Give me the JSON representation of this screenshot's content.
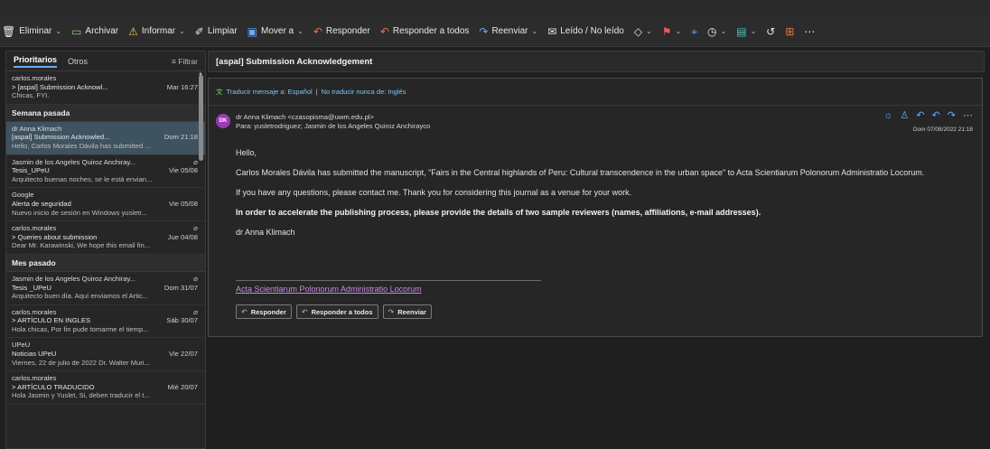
{
  "toolbar": {
    "items": [
      {
        "icon": "trash-icon",
        "glyph": "🗑",
        "label": "Eliminar",
        "chev": true,
        "color": ""
      },
      {
        "icon": "archive-icon",
        "glyph": "▭",
        "label": "Archivar",
        "chev": false,
        "color": "#7ad06a"
      },
      {
        "icon": "warning-icon",
        "glyph": "⚠",
        "label": "Informar",
        "chev": true,
        "color": "#f2c94c"
      },
      {
        "icon": "broom-icon",
        "glyph": "✐",
        "label": "Limpiar",
        "chev": false,
        "color": ""
      },
      {
        "icon": "folder-move-icon",
        "glyph": "▣",
        "label": "Mover a",
        "chev": true,
        "color": "#6aa9ff"
      },
      {
        "icon": "reply-icon",
        "glyph": "↶",
        "label": "Responder",
        "chev": false,
        "color": "#e8734a"
      },
      {
        "icon": "reply-all-icon",
        "glyph": "↶",
        "label": "Responder a todos",
        "chev": false,
        "color": "#e8734a"
      },
      {
        "icon": "forward-icon",
        "glyph": "↷",
        "label": "Reenviar",
        "chev": true,
        "color": "#6aa9ff"
      },
      {
        "icon": "envelope-icon",
        "glyph": "✉",
        "label": "Leído / No leído",
        "chev": false,
        "color": ""
      }
    ],
    "extras": [
      {
        "icon": "tag-icon",
        "glyph": "◇",
        "color": "",
        "chev": true
      },
      {
        "icon": "flag-icon",
        "glyph": "⚑",
        "color": "#f05a5a",
        "chev": true
      },
      {
        "icon": "pin-icon",
        "glyph": "⌖",
        "color": "#6aa9ff",
        "chev": false
      },
      {
        "icon": "clock-icon",
        "glyph": "◷",
        "color": "",
        "chev": true
      },
      {
        "icon": "rules-icon",
        "glyph": "▤",
        "color": "#4fc3c0",
        "chev": true
      },
      {
        "icon": "undo-icon",
        "glyph": "↺",
        "color": "",
        "chev": false
      },
      {
        "icon": "apps-icon",
        "glyph": "⊞",
        "color": "#e8734a",
        "chev": false
      },
      {
        "icon": "more-icon",
        "glyph": "⋯",
        "color": "",
        "chev": false
      }
    ]
  },
  "list": {
    "tab_focused": "Prioritarios",
    "tab_other": "Otros",
    "filter": "Filtrar",
    "groups": [
      {
        "title": "",
        "messages": [
          {
            "from": "carlos.morales",
            "subject": "> [aspal] Submission Acknowl...",
            "date": "Mar 16:27",
            "preview": "Chicas, FYI.",
            "clip": false,
            "selected": false
          }
        ]
      },
      {
        "title": "Semana pasada",
        "messages": [
          {
            "from": "dr Anna Klimach",
            "subject": "[aspal] Submission Acknowled...",
            "date": "Dom 21:18",
            "preview": "Hello, Carlos Morales Dávila has submitted ...",
            "clip": false,
            "selected": true
          },
          {
            "from": "Jasmin de los Angeles Quiroz Anchiray...",
            "subject": "Tesis_UPeU",
            "date": "Vie 05/08",
            "preview": "Arquitecto buenas noches, se le está envian...",
            "clip": true,
            "selected": false
          },
          {
            "from": "Google",
            "subject": "Alerta de seguridad",
            "date": "Vie 05/08",
            "preview": "Nuevo inicio de sesión en Windows yusletr...",
            "clip": false,
            "selected": false
          },
          {
            "from": "carlos.morales",
            "subject": "> Queries about submission",
            "date": "Jue 04/08",
            "preview": "Dear Mr. Karawinski, We hope this email fin...",
            "clip": true,
            "selected": false
          }
        ]
      },
      {
        "title": "Mes pasado",
        "messages": [
          {
            "from": "Jasmin de los Angeles Quiroz Anchiray...",
            "subject": "Tesis _UPeU",
            "date": "Dom 31/07",
            "preview": "Arquitecto buen día. Aquí enviamos el Artic...",
            "clip": true,
            "selected": false
          },
          {
            "from": "carlos.morales",
            "subject": "> ARTÍCULO EN INGLES",
            "date": "Sáb 30/07",
            "preview": "Hola chicas, Por fin pude tomarme el tiemp...",
            "clip": true,
            "selected": false
          },
          {
            "from": "UPeU",
            "subject": "Noticias UPeU",
            "date": "Vie 22/07",
            "preview": "Viernes, 22 de julio de 2022 Dr. Walter Muri...",
            "clip": false,
            "selected": false
          },
          {
            "from": "carlos.morales",
            "subject": "> ARTÍCULO TRADUCIDO",
            "date": "Mié 20/07",
            "preview": "Hola Jasmin y Yuslet, Si, deben traducir el t...",
            "clip": false,
            "selected": false
          }
        ]
      }
    ]
  },
  "reading": {
    "subject": "[aspal] Submission Acknowledgement",
    "translate_link": "Traducir mensaje a: Español",
    "translate_sep": "|",
    "no_translate": "No traducir nunca de: Inglés",
    "avatar_initials": "DK",
    "from_line": "dr Anna Klimach <czasopisma@uwm.edu.pl>",
    "to_line": "Para: yusletrodriguez; Jasmin de los Angeles Quiroz Anchirayco",
    "date": "Dom 07/08/2022 21:18",
    "body": {
      "greeting": "Hello,",
      "p1": "Carlos Morales Dávila has submitted the manuscript, \"Fairs in the Central highlands of Peru: Cultural transcendence in the urban space\" to Acta Scientiarum Polonorum Administratio Locorum.",
      "p2": "If you have any questions, please contact me. Thank you for considering this journal as a venue for your work.",
      "p3": "In order to accelerate the publishing process, please provide the details of two sample reviewers (names, affiliations, e-mail addresses).",
      "signature": "dr Anna Klimach"
    },
    "footer_link": "Acta Scientiarum Polonorum Administratio Locorum",
    "buttons": {
      "reply": "Responder",
      "reply_all": "Responder a todos",
      "forward": "Reenviar"
    }
  }
}
